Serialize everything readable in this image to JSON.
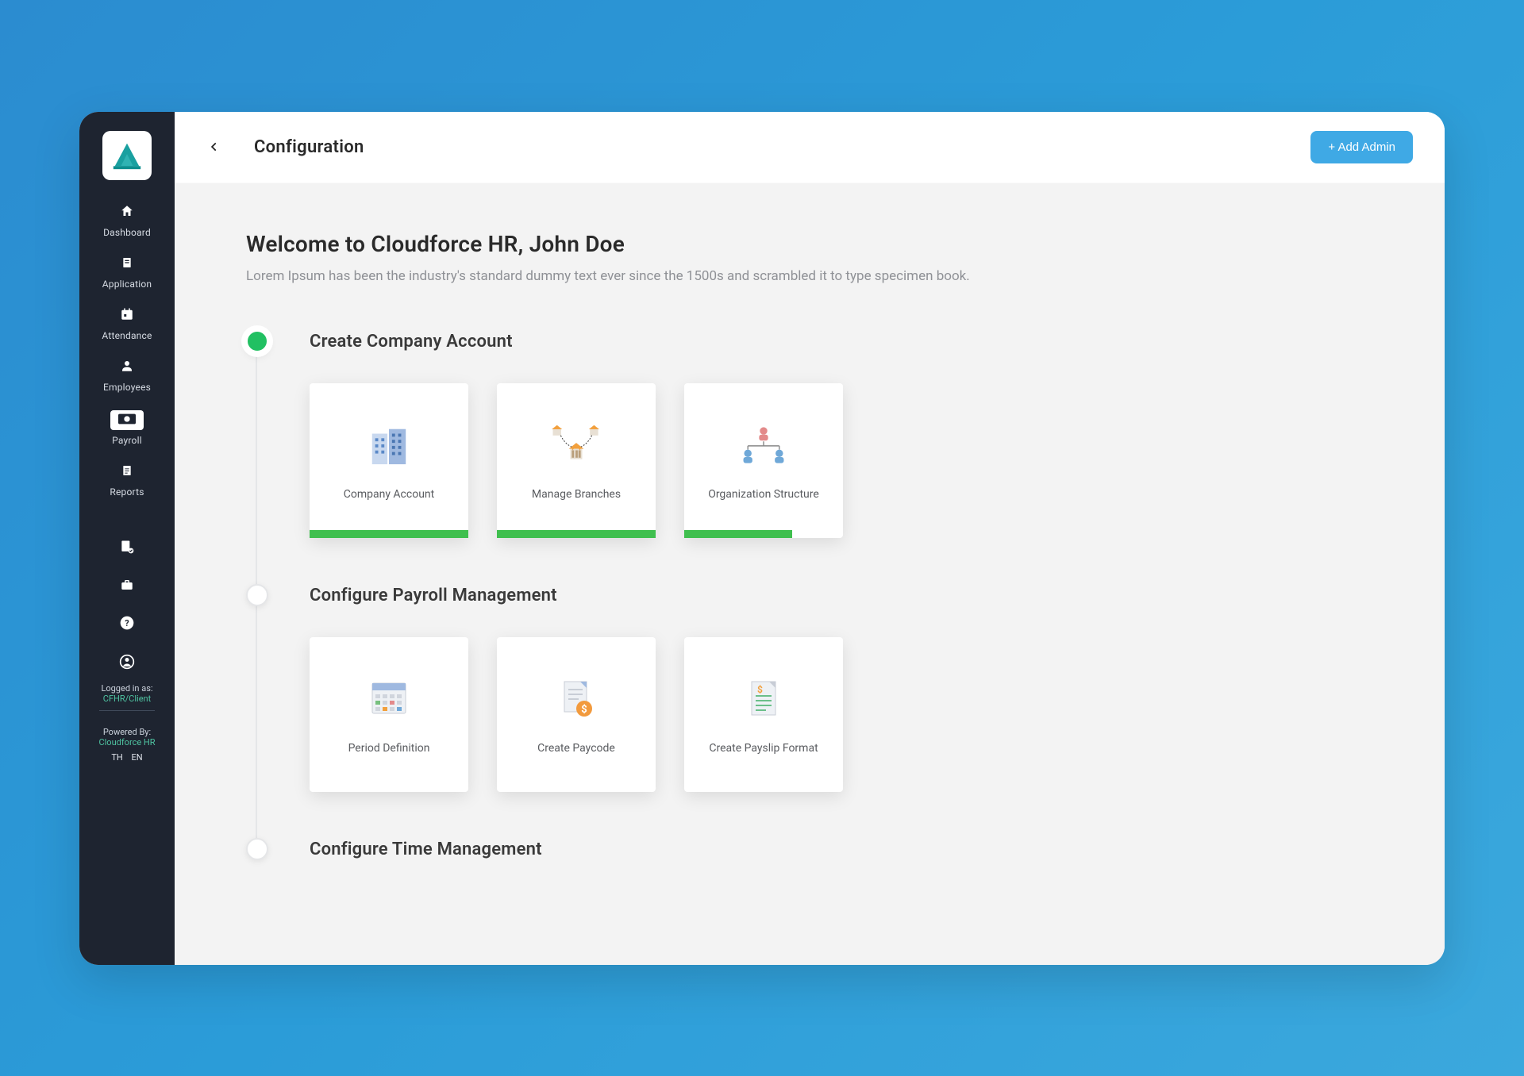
{
  "header": {
    "title": "Configuration",
    "add_admin_label": "+ Add Admin"
  },
  "welcome": {
    "title": "Welcome to Cloudforce HR, John Doe",
    "subtitle": "Lorem Ipsum has been the industry's standard dummy text ever since the 1500s and scrambled it to type specimen book."
  },
  "sidebar": {
    "items": [
      {
        "label": "Dashboard"
      },
      {
        "label": "Application"
      },
      {
        "label": "Attendance"
      },
      {
        "label": "Employees"
      },
      {
        "label": "Payroll"
      },
      {
        "label": "Reports"
      }
    ],
    "logged_in_label": "Logged in as:",
    "logged_in_value": "CFHR/Client",
    "powered_by_label": "Powered By:",
    "powered_by_value": "Cloudforce HR",
    "lang_th": "TH",
    "lang_en": "EN"
  },
  "steps": [
    {
      "title": "Create Company Account",
      "active": true,
      "cards": [
        {
          "label": "Company Account",
          "progress": "full"
        },
        {
          "label": "Manage Branches",
          "progress": "full"
        },
        {
          "label": "Organization Structure",
          "progress": "partial"
        }
      ]
    },
    {
      "title": "Configure Payroll Management",
      "active": false,
      "cards": [
        {
          "label": "Period Definition"
        },
        {
          "label": "Create Paycode"
        },
        {
          "label": "Create Payslip Format"
        }
      ]
    },
    {
      "title": "Configure Time Management",
      "active": false,
      "cards": []
    }
  ],
  "colors": {
    "accent_blue": "#3fa9e5",
    "accent_green": "#21c062",
    "progress_green": "#3fbf4e",
    "sidebar_bg": "#1e2430"
  }
}
